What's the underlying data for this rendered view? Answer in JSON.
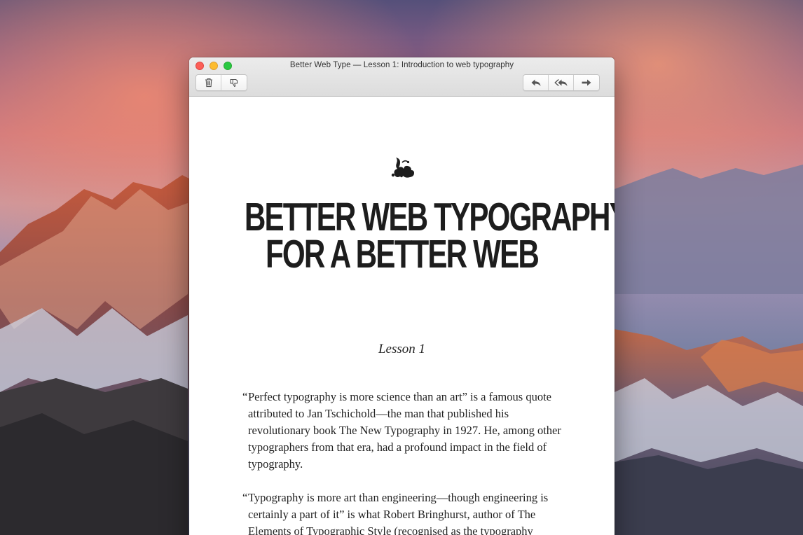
{
  "window": {
    "title": "Better Web Type — Lesson 1: Introduction to web typography"
  },
  "toolbar": {
    "left_buttons": [
      "trash-icon",
      "junk-icon"
    ],
    "right_buttons": [
      "reply-icon",
      "reply-all-icon",
      "forward-icon"
    ]
  },
  "article": {
    "ornament": "fleuron-icon",
    "headline_line1": "BETTER WEB TYPOGRAPHY",
    "headline_line2": "FOR A BETTER WEB",
    "subtitle": "Lesson 1",
    "paragraph1": "Perfect typography is more science than an art” is a famous quote attributed to Jan Tschichold—the man that published his revolutionary book The New Typography in 1927. He, among other typographers from that era, had a profound impact in the field of typography.",
    "paragraph2": "Typography is more art than engineering—though engineering is certainly a part of it” is what Robert Bringhurst, author of The Elements of Typographic Style (recognised as the typography bible), believes in.",
    "open_quote": "“"
  },
  "colors": {
    "close": "#fc5f57",
    "minimize": "#fdbc2e",
    "zoom": "#28c840",
    "text": "#1d1d1d"
  }
}
